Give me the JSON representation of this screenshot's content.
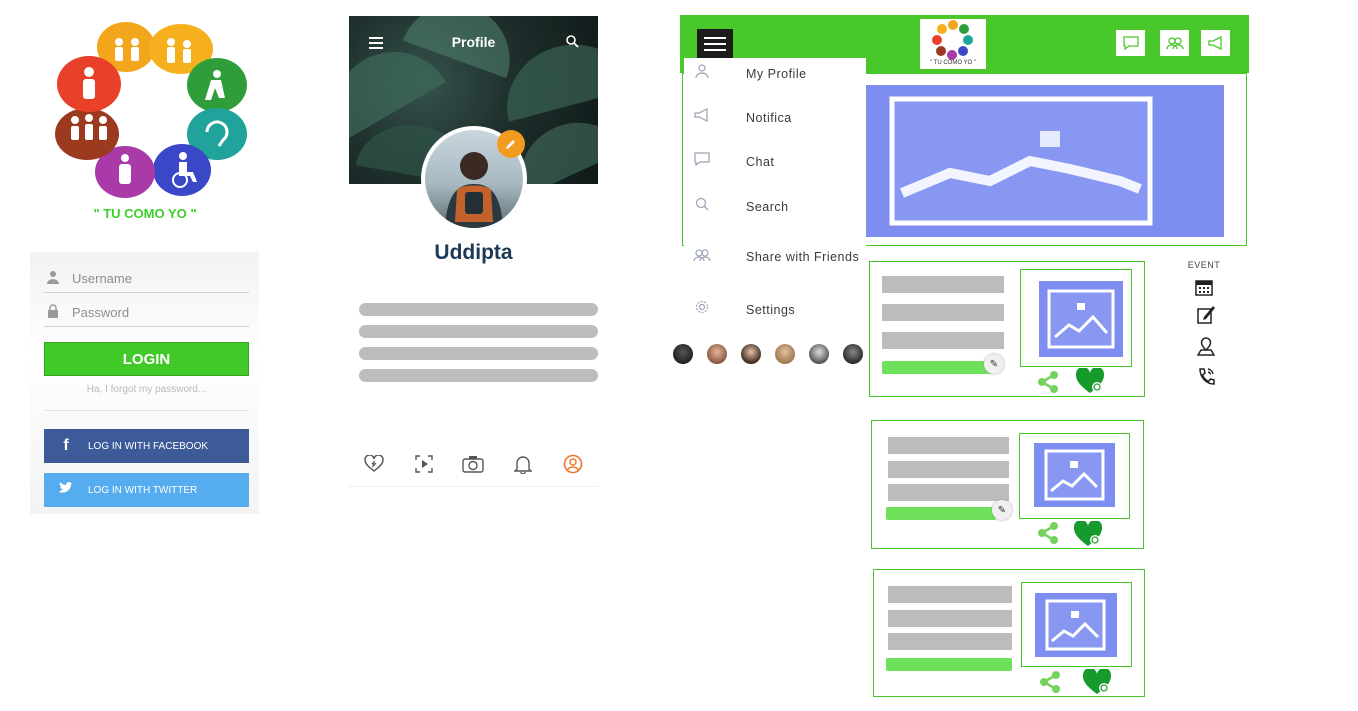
{
  "logo": {
    "tagline": "\" TU COMO YO \"",
    "colors": [
      "#f3a51c",
      "#2f9e3a",
      "#1fa39a",
      "#3a48c8",
      "#a93aa8",
      "#9b3a1f",
      "#e9402a"
    ],
    "icon": "accessibility-community-icon"
  },
  "login": {
    "username_placeholder": "Username",
    "password_placeholder": "Password",
    "login_label": "LOGIN",
    "forgot_text": "Ha, I forgot my password...",
    "facebook_label": "LOG IN WITH FACEBOOK",
    "twitter_label": "LOG IN WITH TWITTER",
    "facebook_color": "#3d5a99",
    "twitter_color": "#55acee",
    "accent": "#41c92a"
  },
  "profile": {
    "title": "Profile",
    "name": "Uddipta",
    "tabs": [
      "heart-plus-icon",
      "video-icon",
      "camera-icon",
      "bell-icon",
      "user-icon"
    ],
    "active_tab_color": "#f0772a",
    "edit_color": "#f29c1f"
  },
  "app": {
    "header_color": "#48c82b",
    "logo_caption": "\" TU COMO YO \"",
    "header_icons": [
      "chat-icon",
      "friends-icon",
      "megaphone-icon"
    ],
    "drawer": [
      {
        "icon": "user-icon",
        "label": "My Profile"
      },
      {
        "icon": "megaphone-icon",
        "label": "Notifica"
      },
      {
        "icon": "chat-icon",
        "label": "Chat"
      },
      {
        "icon": "search-icon",
        "label": "Search"
      },
      {
        "icon": "friends-icon",
        "label": "Share with Friends"
      },
      {
        "icon": "gear-icon",
        "label": "Settings"
      }
    ],
    "event_label": "EVENT",
    "event_icons": [
      "calendar-icon",
      "edit-note-icon",
      "location-icon",
      "phone-icon"
    ],
    "placeholder_color": "#7d8ef0"
  }
}
